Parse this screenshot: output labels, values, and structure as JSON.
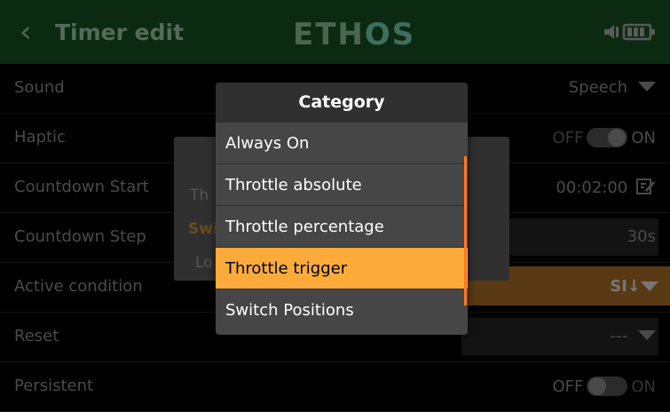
{
  "header": {
    "title": "Timer edit",
    "back_glyph": "‹",
    "logo_left": "ETH",
    "logo_right": "OS"
  },
  "rows": [
    {
      "label": "Sound",
      "value": "Speech"
    },
    {
      "label": "Haptic",
      "off": "OFF",
      "on": "ON",
      "state": "on"
    },
    {
      "label": "Countdown Start",
      "value": "00:02:00"
    },
    {
      "label": "Countdown Step",
      "value": "30s"
    },
    {
      "label": "Active condition",
      "value": "SI↓"
    },
    {
      "label": "Reset",
      "value": "---"
    },
    {
      "label": "Persistent",
      "off": "OFF",
      "on": "ON",
      "state": "off"
    }
  ],
  "background_dialog": {
    "line1": "Th",
    "line2": "Swi",
    "line3": "Lo"
  },
  "dialog": {
    "title": "Category",
    "items": [
      "Always On",
      "Throttle absolute",
      "Throttle percentage",
      "Throttle trigger",
      "Switch Positions"
    ],
    "selected_index": 3
  },
  "colors": {
    "accent": "#fcab3b",
    "scrollbar": "#fc7a1e",
    "header_bg": "#0c2a12",
    "dialog_bg": "#464646"
  },
  "icons": [
    "back-chevron-icon",
    "speaker-icon",
    "battery-icon",
    "edit-icon",
    "caret-down-icon"
  ]
}
